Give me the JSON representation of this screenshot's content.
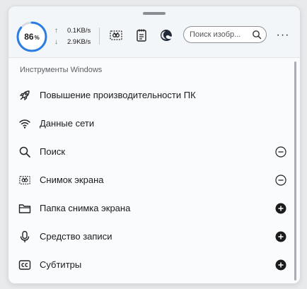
{
  "header": {
    "cpu_percent": 86,
    "cpu_value": "86",
    "cpu_unit": "%",
    "upload_speed": "0.1KB/s",
    "download_speed": "2.9KB/s",
    "upload_arrow": "↑",
    "download_arrow": "↓",
    "search_placeholder": "Поиск изобр...",
    "more_label": "···",
    "icons": [
      "screenshot-icon",
      "notes-icon",
      "edge-browser-icon"
    ],
    "gauge_color": "#2a7de1"
  },
  "section": {
    "title": "Инструменты Windows"
  },
  "items": [
    {
      "label": "Повышение производительности ПК",
      "icon": "rocket-icon",
      "action": "none"
    },
    {
      "label": "Данные сети",
      "icon": "wifi-icon",
      "action": "none"
    },
    {
      "label": "Поиск",
      "icon": "search-icon",
      "action": "remove"
    },
    {
      "label": "Снимок экрана",
      "icon": "screenshot-icon",
      "action": "remove"
    },
    {
      "label": "Папка снимка экрана",
      "icon": "folder-icon",
      "action": "add"
    },
    {
      "label": "Средство записи",
      "icon": "microphone-icon",
      "action": "add"
    },
    {
      "label": "Субтитры",
      "icon": "captions-icon",
      "action": "add"
    }
  ]
}
